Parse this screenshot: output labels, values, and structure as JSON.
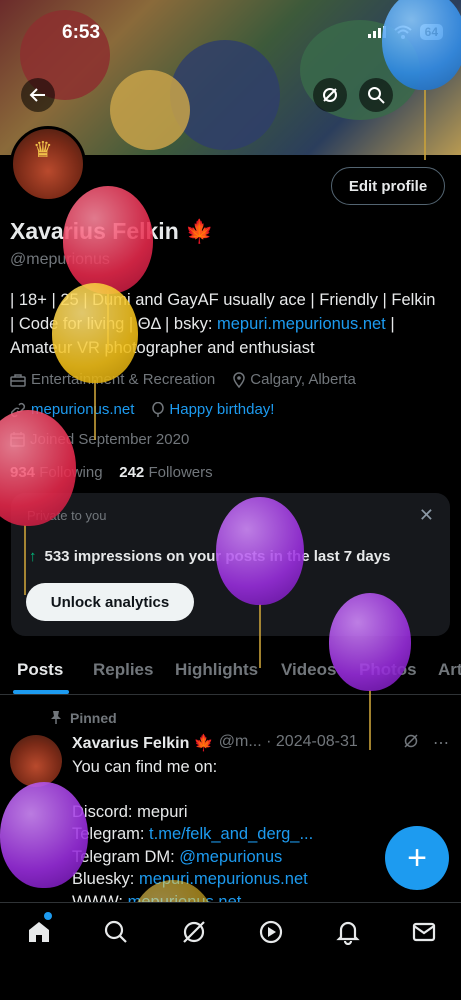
{
  "status_bar": {
    "time": "6:53",
    "battery": "64"
  },
  "profile": {
    "edit_label": "Edit profile",
    "name": "Xavarius Felkin 🍁",
    "handle": "@mepurionus",
    "bio_line1": "| 18+ | 25 | Dumi and GayAF usually ace | Friendly | Felkin",
    "bio_line2_a": "| Code for living | ΘΔ | bsky: ",
    "bio_link": "mepuri.mepurionus.net",
    "bio_line2_b": " |",
    "bio_line3": "Amateur VR photographer and enthusiast",
    "category": "Entertainment & Recreation",
    "location": "Calgary, Alberta",
    "website": "mepurionus.net",
    "birthday": "Happy birthday!",
    "joined": "Joined September 2020",
    "following_count": "934",
    "following_label": "Following",
    "followers_count": "242",
    "followers_label": "Followers"
  },
  "analytics_card": {
    "private_label": "Private to you",
    "impressions_text": "533 impressions on your posts in the last 7 days",
    "unlock_label": "Unlock analytics"
  },
  "tabs": [
    "Posts",
    "Replies",
    "Highlights",
    "Videos",
    "Photos",
    "Art"
  ],
  "pinned_post": {
    "pinned_label": "Pinned",
    "author": "Xavarius Felkin 🍁",
    "meta": "@m... · 2024-08-31",
    "line1": "You can find me on:",
    "line2": "Discord: mepuri",
    "telegram_label": "Telegram: ",
    "telegram_link": "t.me/felk_and_derg_...",
    "telegram_dm_label": "Telegram DM: ",
    "telegram_dm_link": "@mepurionus",
    "bluesky_label": "Bluesky: ",
    "bluesky_link": "mepuri.mepurionus.net",
    "www_label": "WWW: ",
    "www_link": "mepurionus.net"
  },
  "colors": {
    "accent": "#1d9bf0",
    "background": "#000000",
    "muted": "#71767b"
  },
  "icons": [
    "back-icon",
    "grok-icon",
    "search-icon",
    "home-icon",
    "explore-icon",
    "grok-nav-icon",
    "video-icon",
    "notifications-icon",
    "messages-icon",
    "compose-icon"
  ]
}
